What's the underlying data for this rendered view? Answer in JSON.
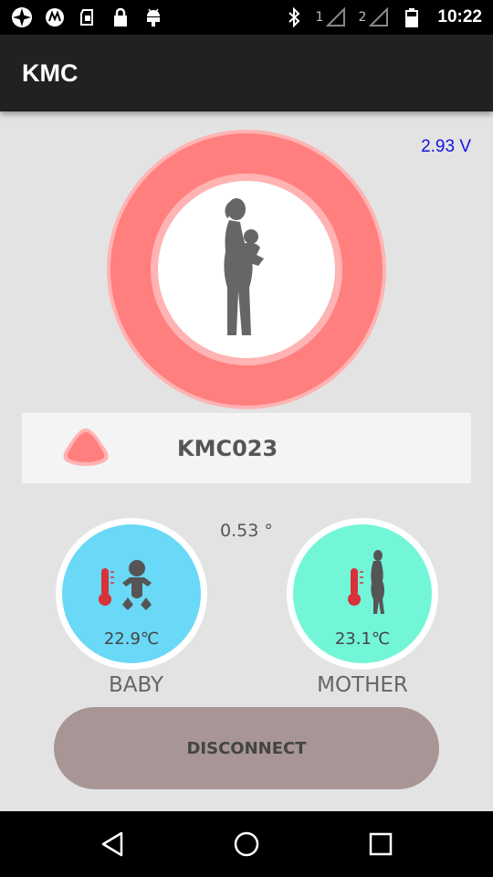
{
  "status_bar": {
    "time": "10:22",
    "sim1_label": "1",
    "sim2_label": "2",
    "icons": [
      "aperture-icon",
      "motorola-icon",
      "sim-icon",
      "lock-icon",
      "android-icon",
      "bluetooth-icon",
      "signal-icon",
      "signal-icon",
      "battery-icon"
    ]
  },
  "app_bar": {
    "title": "KMC"
  },
  "voltage": "2.93 V",
  "device": {
    "name": "KMC023",
    "status_color": "#ff7f7f"
  },
  "angle": "0.53 °",
  "baby": {
    "temperature": "22.9℃",
    "label": "BABY",
    "color": "#6ad8f7"
  },
  "mother": {
    "temperature": "23.1℃",
    "label": "MOTHER",
    "color": "#73f5d8"
  },
  "disconnect_label": "DISCONNECT",
  "colors": {
    "ring": "#ff7f7f",
    "ring_halo": "#ffb3b3",
    "thermometer": "#d9323a",
    "button": "#a89595"
  },
  "nav": [
    "back-icon",
    "home-icon",
    "recents-icon"
  ]
}
